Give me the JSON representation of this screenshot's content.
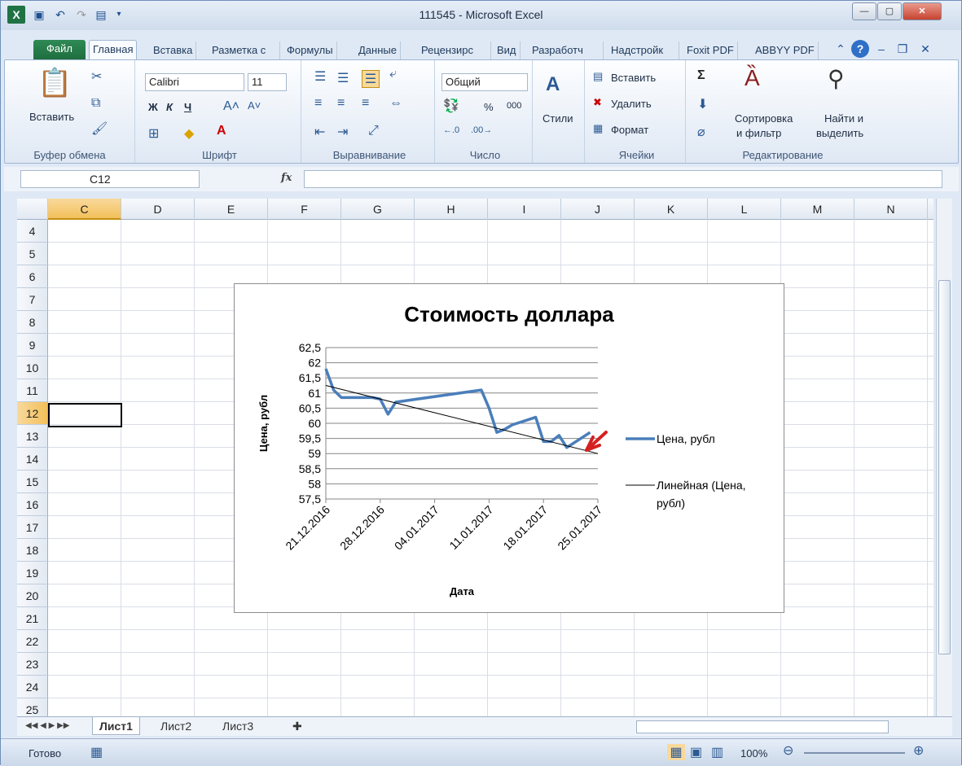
{
  "window": {
    "title": "111545 - Microsoft Excel"
  },
  "tabs": [
    "Файл",
    "Главная",
    "Вставка",
    "Разметка с",
    "Формулы",
    "Данные",
    "Рецензирс",
    "Вид",
    "Разработч",
    "Надстройк",
    "Foxit PDF",
    "ABBYY PDF"
  ],
  "ribbon": {
    "clipboard": {
      "label": "Буфер обмена",
      "paste": "Вставить"
    },
    "font": {
      "label": "Шрифт",
      "name": "Calibri",
      "size": "11",
      "bold": "Ж",
      "italic": "К",
      "underline": "Ч"
    },
    "align": {
      "label": "Выравнивание"
    },
    "number": {
      "label": "Число",
      "format": "Общий",
      "percent": "%",
      "thousands": "000"
    },
    "styles": {
      "label": "Стили"
    },
    "cells": {
      "label": "Ячейки",
      "insert": "Вставить",
      "delete": "Удалить",
      "format": "Формат"
    },
    "editing": {
      "label": "Редактирование",
      "sort": "Сортировка",
      "sort2": "и фильтр",
      "find": "Найти и",
      "find2": "выделить"
    }
  },
  "formula_bar": {
    "name_box": "C12",
    "fx": "fx",
    "value": ""
  },
  "columns": [
    "C",
    "D",
    "E",
    "F",
    "G",
    "H",
    "I",
    "J",
    "K",
    "L",
    "M",
    "N"
  ],
  "rows": [
    "4",
    "5",
    "6",
    "7",
    "8",
    "9",
    "10",
    "11",
    "12",
    "13",
    "14",
    "15",
    "16",
    "17",
    "18",
    "19",
    "20",
    "21",
    "22",
    "23",
    "24",
    "25"
  ],
  "selected": {
    "column": "C",
    "row": "12"
  },
  "sheets": [
    "Лист1",
    "Лист2",
    "Лист3"
  ],
  "status": {
    "ready": "Готово",
    "zoom": "100%"
  },
  "chart_data": {
    "type": "line",
    "title": "Стоимость доллара",
    "xlabel": "Дата",
    "ylabel": "Цена, рубл",
    "ylim": [
      57.5,
      62.5
    ],
    "yticks": [
      "62,5",
      "62",
      "61,5",
      "61",
      "60,5",
      "60",
      "59,5",
      "59",
      "58,5",
      "58",
      "57,5"
    ],
    "xticks": [
      "21.12.2016",
      "28.12.2016",
      "04.01.2017",
      "11.01.2017",
      "18.01.2017",
      "25.01.2017"
    ],
    "series": [
      {
        "name": "Цена, рубл",
        "color": "#4a7ebb",
        "x": [
          "21.12.2016",
          "22.12.2016",
          "23.12.2016",
          "24.12.2016",
          "27.12.2016",
          "28.12.2016",
          "29.12.2016",
          "30.12.2016",
          "10.01.2017",
          "11.01.2017",
          "12.01.2017",
          "13.01.2017",
          "14.01.2017",
          "17.01.2017",
          "18.01.2017",
          "19.01.2017",
          "20.01.2017",
          "21.01.2017",
          "24.01.2017"
        ],
        "values": [
          61.8,
          61.1,
          60.85,
          60.85,
          60.85,
          60.8,
          60.3,
          60.7,
          61.1,
          60.5,
          59.7,
          59.8,
          59.95,
          60.2,
          59.4,
          59.4,
          59.6,
          59.2,
          59.7
        ]
      },
      {
        "name": "Линейная (Цена, рубл)",
        "color": "#000000",
        "type": "trendline",
        "x": [
          "21.12.2016",
          "25.01.2017"
        ],
        "values": [
          61.25,
          59.0
        ]
      }
    ]
  }
}
